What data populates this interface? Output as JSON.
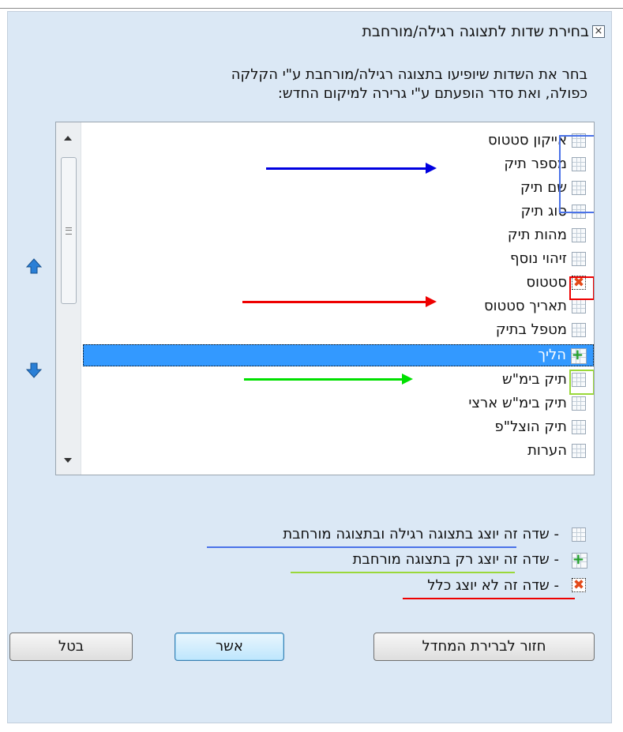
{
  "title": "בחירת שדות לתצוגה רגילה/מורחבת",
  "close_glyph": "⊠",
  "instructions_line1": "בחר את השדות שיופיעו בתצוגה רגילה/מורחבת ע\"י הקלקה",
  "instructions_line2": "כפולה, ואת סדר הופעתם ע\"י גרירה למיקום החדש:",
  "fields": [
    {
      "label": "אייקון סטטוס",
      "mode": "regular-and-extended"
    },
    {
      "label": "מספר תיק",
      "mode": "regular-and-extended"
    },
    {
      "label": "שם תיק",
      "mode": "regular-and-extended"
    },
    {
      "label": "סוג תיק",
      "mode": "regular-and-extended"
    },
    {
      "label": "מהות תיק",
      "mode": "regular-and-extended"
    },
    {
      "label": "זיהוי נוסף",
      "mode": "regular-and-extended"
    },
    {
      "label": "סטטוס",
      "mode": "hidden"
    },
    {
      "label": "תאריך סטטוס",
      "mode": "regular-and-extended"
    },
    {
      "label": "מטפל בתיק",
      "mode": "regular-and-extended"
    },
    {
      "label": "הליך",
      "mode": "extended-only",
      "selected": true
    },
    {
      "label": "תיק בימ\"ש",
      "mode": "regular-and-extended"
    },
    {
      "label": "תיק בימ\"ש ארצי",
      "mode": "regular-and-extended"
    },
    {
      "label": "תיק הוצל\"פ",
      "mode": "regular-and-extended"
    },
    {
      "label": "הערות",
      "mode": "regular-and-extended"
    }
  ],
  "legend": {
    "regular_and_extended": "- שדה זה יוצג בתצוגה רגילה ובתצוגה מורחבת",
    "extended_only": "- שדה זה יוצג רק בתצוגה מורחבת",
    "hidden": "- שדה זה לא יוצג כלל"
  },
  "buttons": {
    "cancel": "בטל",
    "ok": "אשר",
    "restore_default": "חזור לברירת המחדל"
  },
  "colors": {
    "dialog_bg": "#dbe8f5",
    "selection": "#3399ff",
    "annot_blue": "#0000e0",
    "annot_red": "#ee0000",
    "annot_green": "#00e000",
    "box_blue": "#4a72e8",
    "box_green": "#9ad83a"
  }
}
